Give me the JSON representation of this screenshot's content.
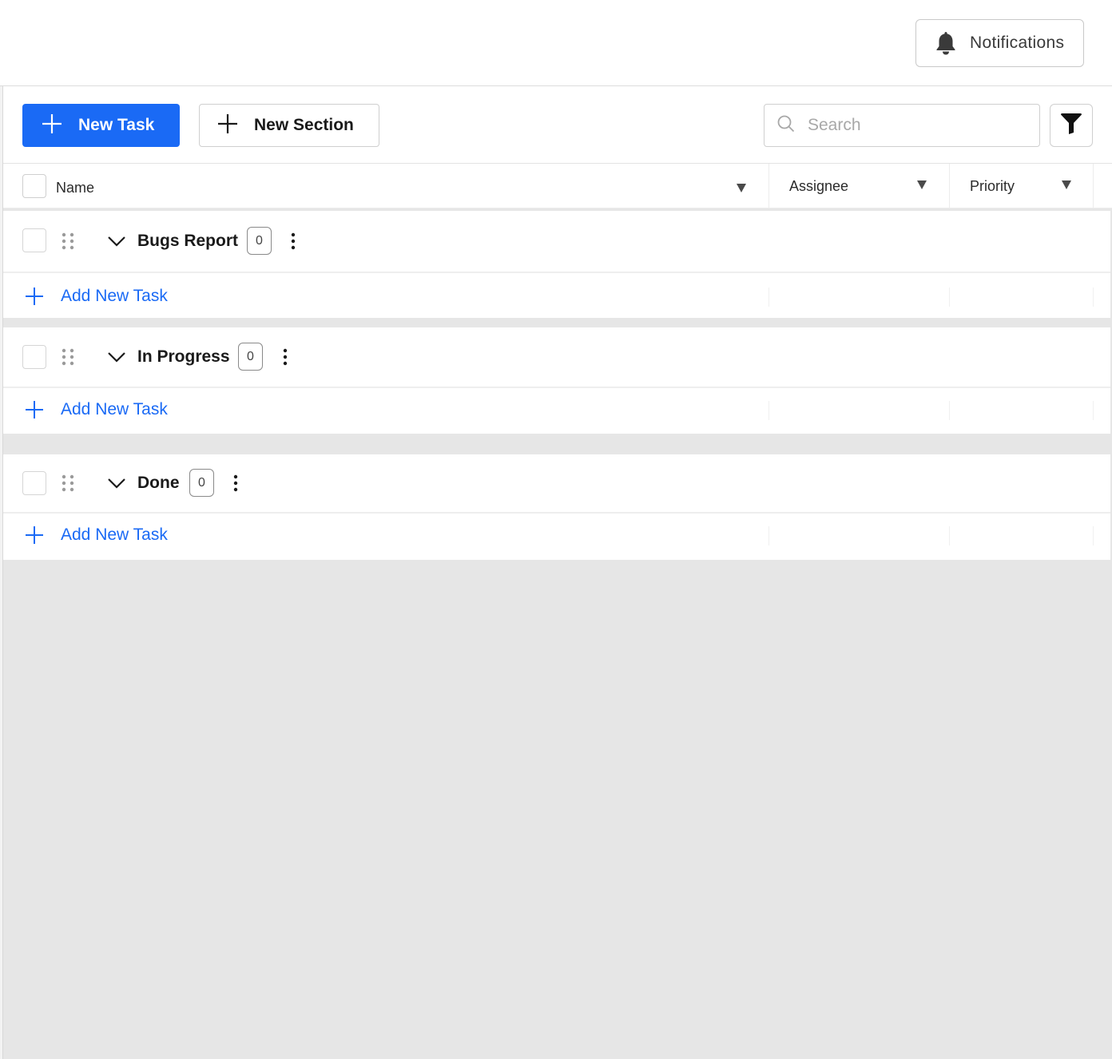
{
  "header": {
    "notifications_label": "Notifications",
    "notifications_icon": "bell-icon"
  },
  "toolbar": {
    "new_task_label": "New Task",
    "new_section_label": "New Section",
    "search_placeholder": "Search",
    "primary_color": "#1a6af5"
  },
  "table": {
    "columns": [
      {
        "label": "Name"
      },
      {
        "label": "Assignee"
      },
      {
        "label": "Priority"
      }
    ]
  },
  "sections": [
    {
      "title": "Bugs Report",
      "count": "0",
      "add_label": "Add New Task"
    },
    {
      "title": "In Progress",
      "count": "0",
      "add_label": "Add New Task"
    },
    {
      "title": "Done",
      "count": "0",
      "add_label": "Add New Task"
    }
  ]
}
